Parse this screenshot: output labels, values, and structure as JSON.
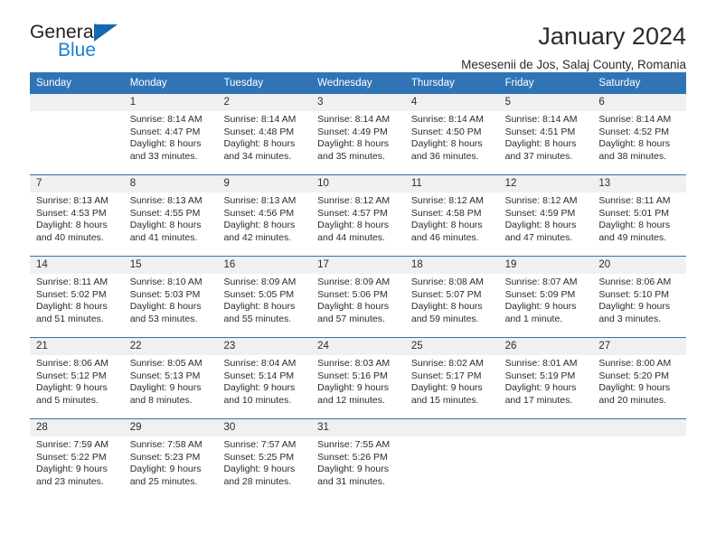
{
  "brand": {
    "name_part1": "General",
    "name_part2": "Blue",
    "triangle_color": "#1268b3",
    "blue_color": "#1a7fd4"
  },
  "header": {
    "title": "January 2024",
    "subtitle": "Mesesenii de Jos, Salaj County, Romania"
  },
  "theme": {
    "header_blue": "#3074b6",
    "day_band_gray": "#f0f0f0",
    "text_color": "#2b2b2b",
    "header_text_color": "#ffffff"
  },
  "weekdays": [
    "Sunday",
    "Monday",
    "Tuesday",
    "Wednesday",
    "Thursday",
    "Friday",
    "Saturday"
  ],
  "weeks": [
    [
      {
        "day": "",
        "lines": []
      },
      {
        "day": "1",
        "lines": [
          "Sunrise: 8:14 AM",
          "Sunset: 4:47 PM",
          "Daylight: 8 hours",
          "and 33 minutes."
        ]
      },
      {
        "day": "2",
        "lines": [
          "Sunrise: 8:14 AM",
          "Sunset: 4:48 PM",
          "Daylight: 8 hours",
          "and 34 minutes."
        ]
      },
      {
        "day": "3",
        "lines": [
          "Sunrise: 8:14 AM",
          "Sunset: 4:49 PM",
          "Daylight: 8 hours",
          "and 35 minutes."
        ]
      },
      {
        "day": "4",
        "lines": [
          "Sunrise: 8:14 AM",
          "Sunset: 4:50 PM",
          "Daylight: 8 hours",
          "and 36 minutes."
        ]
      },
      {
        "day": "5",
        "lines": [
          "Sunrise: 8:14 AM",
          "Sunset: 4:51 PM",
          "Daylight: 8 hours",
          "and 37 minutes."
        ]
      },
      {
        "day": "6",
        "lines": [
          "Sunrise: 8:14 AM",
          "Sunset: 4:52 PM",
          "Daylight: 8 hours",
          "and 38 minutes."
        ]
      }
    ],
    [
      {
        "day": "7",
        "lines": [
          "Sunrise: 8:13 AM",
          "Sunset: 4:53 PM",
          "Daylight: 8 hours",
          "and 40 minutes."
        ]
      },
      {
        "day": "8",
        "lines": [
          "Sunrise: 8:13 AM",
          "Sunset: 4:55 PM",
          "Daylight: 8 hours",
          "and 41 minutes."
        ]
      },
      {
        "day": "9",
        "lines": [
          "Sunrise: 8:13 AM",
          "Sunset: 4:56 PM",
          "Daylight: 8 hours",
          "and 42 minutes."
        ]
      },
      {
        "day": "10",
        "lines": [
          "Sunrise: 8:12 AM",
          "Sunset: 4:57 PM",
          "Daylight: 8 hours",
          "and 44 minutes."
        ]
      },
      {
        "day": "11",
        "lines": [
          "Sunrise: 8:12 AM",
          "Sunset: 4:58 PM",
          "Daylight: 8 hours",
          "and 46 minutes."
        ]
      },
      {
        "day": "12",
        "lines": [
          "Sunrise: 8:12 AM",
          "Sunset: 4:59 PM",
          "Daylight: 8 hours",
          "and 47 minutes."
        ]
      },
      {
        "day": "13",
        "lines": [
          "Sunrise: 8:11 AM",
          "Sunset: 5:01 PM",
          "Daylight: 8 hours",
          "and 49 minutes."
        ]
      }
    ],
    [
      {
        "day": "14",
        "lines": [
          "Sunrise: 8:11 AM",
          "Sunset: 5:02 PM",
          "Daylight: 8 hours",
          "and 51 minutes."
        ]
      },
      {
        "day": "15",
        "lines": [
          "Sunrise: 8:10 AM",
          "Sunset: 5:03 PM",
          "Daylight: 8 hours",
          "and 53 minutes."
        ]
      },
      {
        "day": "16",
        "lines": [
          "Sunrise: 8:09 AM",
          "Sunset: 5:05 PM",
          "Daylight: 8 hours",
          "and 55 minutes."
        ]
      },
      {
        "day": "17",
        "lines": [
          "Sunrise: 8:09 AM",
          "Sunset: 5:06 PM",
          "Daylight: 8 hours",
          "and 57 minutes."
        ]
      },
      {
        "day": "18",
        "lines": [
          "Sunrise: 8:08 AM",
          "Sunset: 5:07 PM",
          "Daylight: 8 hours",
          "and 59 minutes."
        ]
      },
      {
        "day": "19",
        "lines": [
          "Sunrise: 8:07 AM",
          "Sunset: 5:09 PM",
          "Daylight: 9 hours",
          "and 1 minute."
        ]
      },
      {
        "day": "20",
        "lines": [
          "Sunrise: 8:06 AM",
          "Sunset: 5:10 PM",
          "Daylight: 9 hours",
          "and 3 minutes."
        ]
      }
    ],
    [
      {
        "day": "21",
        "lines": [
          "Sunrise: 8:06 AM",
          "Sunset: 5:12 PM",
          "Daylight: 9 hours",
          "and 5 minutes."
        ]
      },
      {
        "day": "22",
        "lines": [
          "Sunrise: 8:05 AM",
          "Sunset: 5:13 PM",
          "Daylight: 9 hours",
          "and 8 minutes."
        ]
      },
      {
        "day": "23",
        "lines": [
          "Sunrise: 8:04 AM",
          "Sunset: 5:14 PM",
          "Daylight: 9 hours",
          "and 10 minutes."
        ]
      },
      {
        "day": "24",
        "lines": [
          "Sunrise: 8:03 AM",
          "Sunset: 5:16 PM",
          "Daylight: 9 hours",
          "and 12 minutes."
        ]
      },
      {
        "day": "25",
        "lines": [
          "Sunrise: 8:02 AM",
          "Sunset: 5:17 PM",
          "Daylight: 9 hours",
          "and 15 minutes."
        ]
      },
      {
        "day": "26",
        "lines": [
          "Sunrise: 8:01 AM",
          "Sunset: 5:19 PM",
          "Daylight: 9 hours",
          "and 17 minutes."
        ]
      },
      {
        "day": "27",
        "lines": [
          "Sunrise: 8:00 AM",
          "Sunset: 5:20 PM",
          "Daylight: 9 hours",
          "and 20 minutes."
        ]
      }
    ],
    [
      {
        "day": "28",
        "lines": [
          "Sunrise: 7:59 AM",
          "Sunset: 5:22 PM",
          "Daylight: 9 hours",
          "and 23 minutes."
        ]
      },
      {
        "day": "29",
        "lines": [
          "Sunrise: 7:58 AM",
          "Sunset: 5:23 PM",
          "Daylight: 9 hours",
          "and 25 minutes."
        ]
      },
      {
        "day": "30",
        "lines": [
          "Sunrise: 7:57 AM",
          "Sunset: 5:25 PM",
          "Daylight: 9 hours",
          "and 28 minutes."
        ]
      },
      {
        "day": "31",
        "lines": [
          "Sunrise: 7:55 AM",
          "Sunset: 5:26 PM",
          "Daylight: 9 hours",
          "and 31 minutes."
        ]
      },
      {
        "day": "",
        "lines": []
      },
      {
        "day": "",
        "lines": []
      },
      {
        "day": "",
        "lines": []
      }
    ]
  ]
}
